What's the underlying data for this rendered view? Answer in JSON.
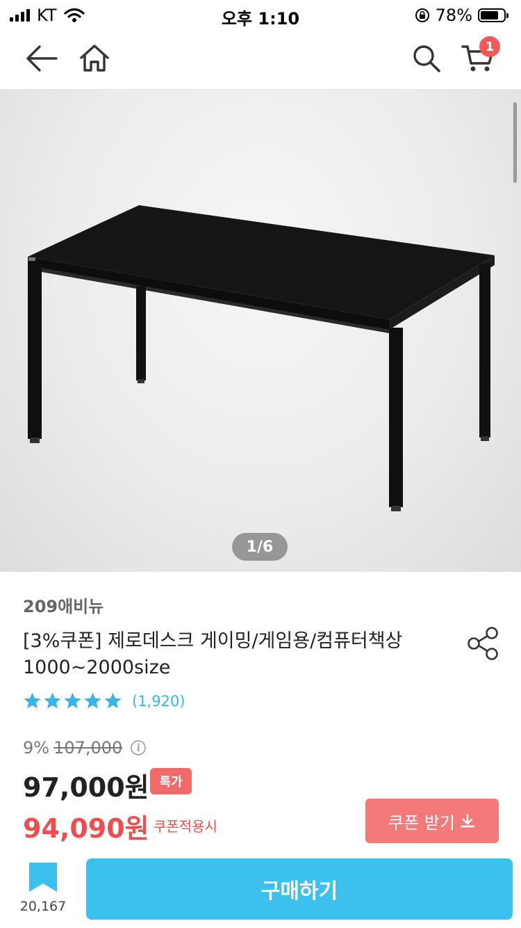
{
  "status_bar": {
    "carrier": "KT",
    "time": "오후 1:10",
    "battery": "78%",
    "battery_level": 0.78
  },
  "nav": {
    "back_icon": "arrow-left-icon",
    "home_icon": "home-icon",
    "search_icon": "search-icon",
    "cart_icon": "cart-icon",
    "cart_count": "1"
  },
  "gallery": {
    "pager": "1/6"
  },
  "product": {
    "brand": "209애비뉴",
    "title_line1": "[3%쿠폰] 제로데스크 게이밍/게임용/컴퓨터책상",
    "title_line2": "1000~2000size",
    "rating_count": "(1,920)",
    "rating_stars": 5,
    "discount_rate": "9%",
    "original_price": "107,000",
    "price": "97,000원",
    "special_badge": "특가",
    "coupon_price": "94,090원",
    "coupon_note": "쿠폰적용시"
  },
  "actions": {
    "coupon_button": "쿠폰 받기",
    "bookmark_count": "20,167",
    "buy_button": "구매하기"
  },
  "colors": {
    "accent": "#3cc1ee",
    "sale": "#ef4e4e",
    "coupon_button": "#f47a7a",
    "star": "#3ab4e8"
  }
}
